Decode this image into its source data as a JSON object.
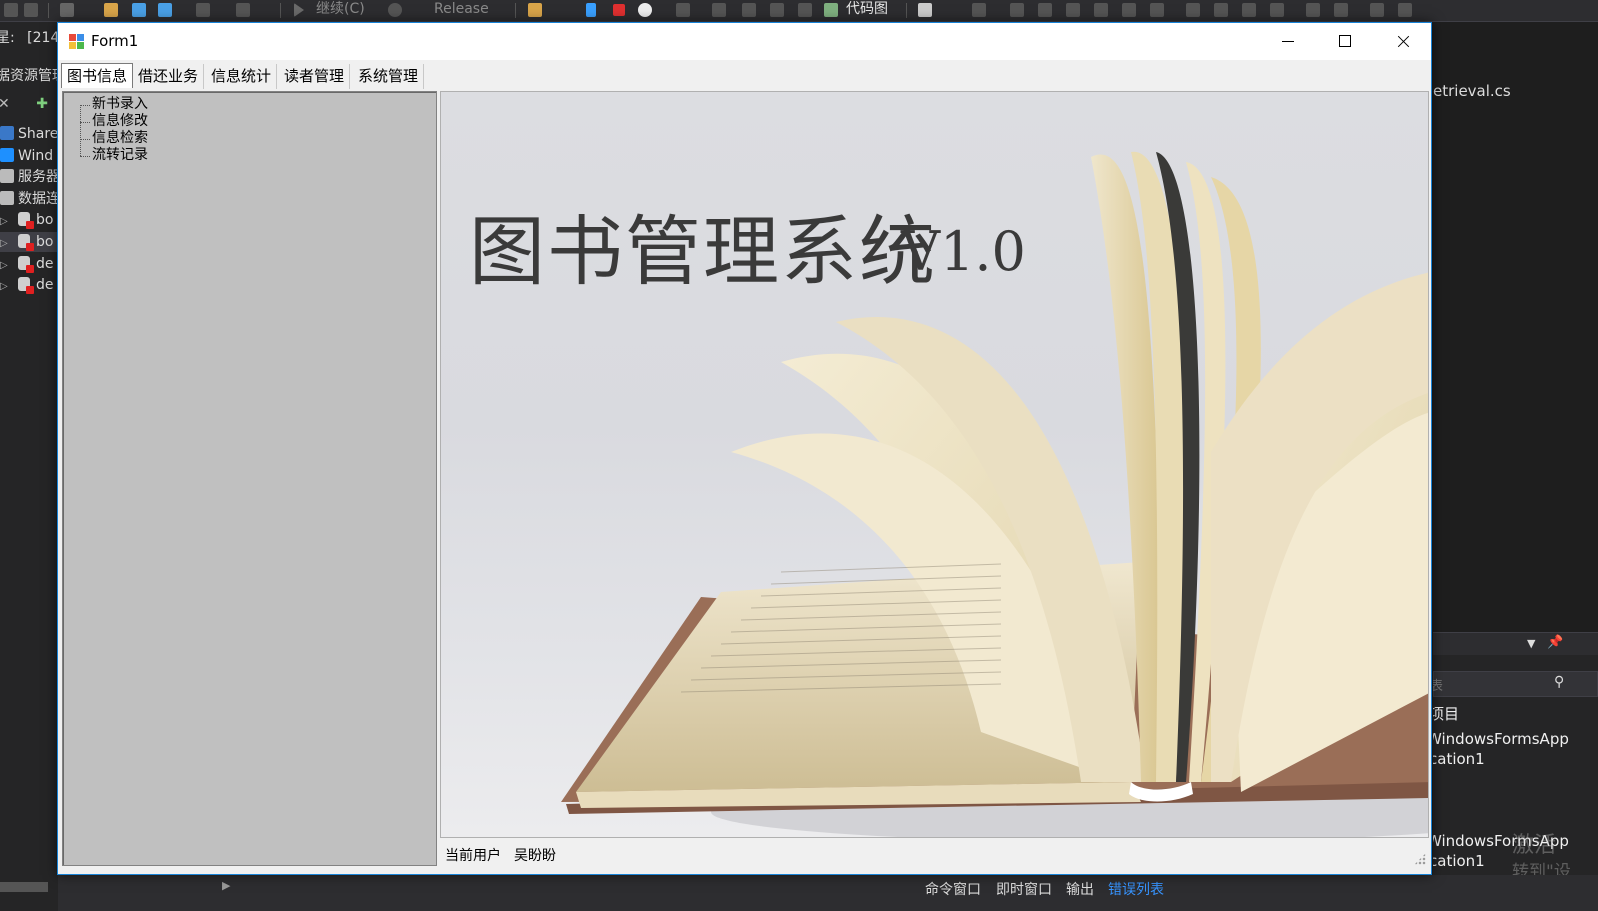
{
  "ide": {
    "toolbar": {
      "continue_label": "继续(C)",
      "config_value": "Release",
      "codemap_label": "代码图"
    },
    "left_panel": {
      "process_label": "星:",
      "process_value": "[214",
      "explorer_title": "据资源管理",
      "items": [
        "Share",
        "Wind",
        "服务器",
        "数据连"
      ],
      "db_items": [
        "bo",
        "bo",
        "de",
        "de"
      ]
    },
    "right_panel": {
      "file_tab": "etrieval.cs",
      "search_hint": "表",
      "section_label": "项目",
      "entries": [
        [
          "WindowsFormsApp",
          "cation1"
        ],
        [
          "WindowsFormsApp",
          "cation1"
        ]
      ]
    },
    "watermark": [
      "激活",
      "转到\"设"
    ],
    "bottom_tabs": [
      "命令窗口",
      "即时窗口",
      "输出",
      "错误列表"
    ],
    "accent_color": "#3794ff"
  },
  "window": {
    "title": "Form1",
    "tabs": [
      "图书信息",
      "借还业务",
      "信息统计",
      "读者管理",
      "系统管理"
    ],
    "selected_tab": "图书信息",
    "tree_items": [
      "新书录入",
      "信息修改",
      "信息检索",
      "流转记录"
    ],
    "banner": {
      "title": "图书管理系统",
      "version": "V1.0"
    },
    "status": {
      "label": "当前用户",
      "value": "吴盼盼"
    },
    "border_color": "#1883d7"
  }
}
